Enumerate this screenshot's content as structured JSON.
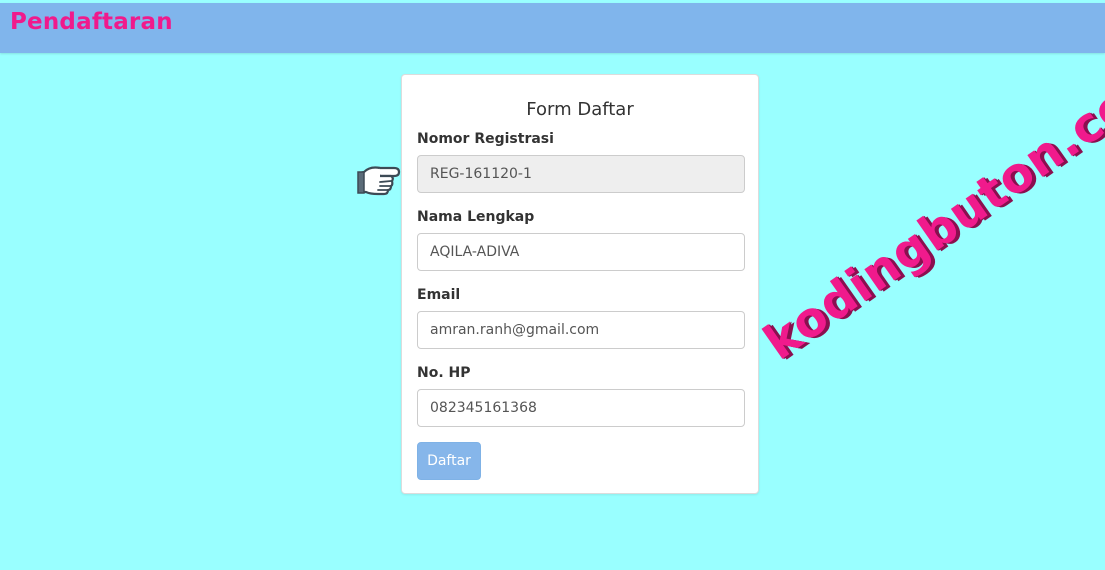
{
  "header": {
    "title": "Pendaftaran"
  },
  "form": {
    "title": "Form Daftar",
    "fields": [
      {
        "label": "Nomor Registrasi",
        "value": "REG-161120-1",
        "readonly": true
      },
      {
        "label": "Nama Lengkap",
        "value": "AQILA-ADIVA",
        "readonly": false
      },
      {
        "label": "Email",
        "value": "amran.ranh@gmail.com",
        "readonly": false
      },
      {
        "label": "No. HP",
        "value": "082345161368",
        "readonly": false
      }
    ],
    "submit_label": "Daftar"
  },
  "decorations": {
    "pointer_icon": "pointing-hand-icon",
    "watermark": "kodingbuton.com"
  },
  "colors": {
    "background": "#99ffff",
    "header_bar": "#80b5ec",
    "brand": "#f01a8c",
    "button": "#86b6ea",
    "readonly_input": "#eeeeee"
  }
}
